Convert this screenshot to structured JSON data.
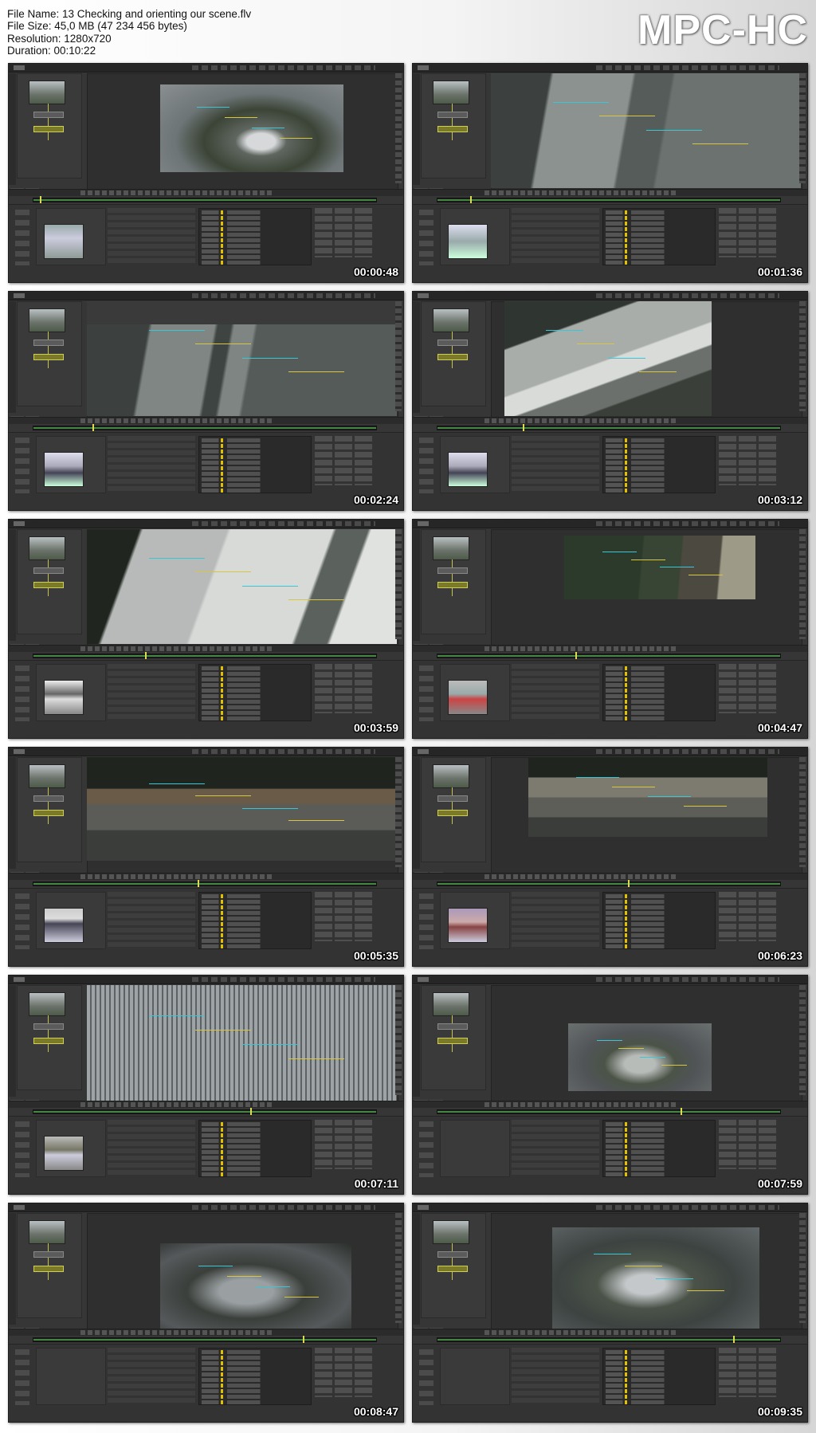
{
  "header": {
    "file_name": "File Name: 13 Checking and orienting our scene.flv",
    "file_size": "File Size: 45,0 MB (47 234 456 bytes)",
    "resolution": "Resolution: 1280x720",
    "duration": "Duration: 00:10:22",
    "brand": "MPC-HC"
  },
  "thumbnails": [
    {
      "timestamp": "00:00:48",
      "scene": "aerial-city-wide"
    },
    {
      "timestamp": "00:01:36",
      "scene": "tower-over-water"
    },
    {
      "timestamp": "00:02:24",
      "scene": "tower-over-water-dark"
    },
    {
      "timestamp": "00:03:12",
      "scene": "buildings-rooftops"
    },
    {
      "timestamp": "00:03:59",
      "scene": "rooftop-closeup"
    },
    {
      "timestamp": "00:04:47",
      "scene": "treetops-path"
    },
    {
      "timestamp": "00:05:35",
      "scene": "building-facade-trees"
    },
    {
      "timestamp": "00:06:23",
      "scene": "building-facade-small"
    },
    {
      "timestamp": "00:07:11",
      "scene": "curved-tower-facade"
    },
    {
      "timestamp": "00:07:59",
      "scene": "small-city-preview"
    },
    {
      "timestamp": "00:08:47",
      "scene": "3d-scene-grid"
    },
    {
      "timestamp": "00:09:35",
      "scene": "3d-scene-warped-plane"
    }
  ],
  "colors": {
    "track_cyan": "#39c6d6",
    "track_yellow": "#d6c640",
    "timeline_green": "#4fa04f",
    "ui_background": "#363636"
  }
}
